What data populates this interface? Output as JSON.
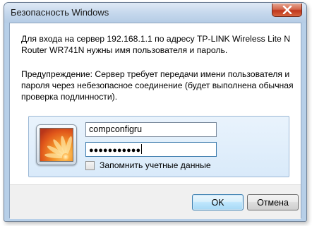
{
  "window": {
    "title": "Безопасность Windows"
  },
  "message": {
    "line1": "Для входа на сервер 192.168.1.1 по адресу TP-LINK Wireless Lite N Router WR741N нужны имя пользователя и пароль.",
    "warning": "Предупреждение: Сервер требует передачи имени пользователя и пароля через небезопасное соединение (будет выполнена обычная проверка подлинности)."
  },
  "credentials": {
    "username_value": "compconfigru",
    "password_masked": "●●●●●●●●●●●",
    "remember_label": "Запомнить учетные данные",
    "remember_checked": false
  },
  "buttons": {
    "ok_label": "OK",
    "cancel_label": "Отмена"
  },
  "icons": {
    "close": "close-icon",
    "avatar": "user-avatar-orange-flower"
  },
  "colors": {
    "title_bar": "#c4d7ec",
    "close_button": "#c0361c",
    "panel_background": "#e2effb",
    "footer": "#f0f0f0"
  }
}
